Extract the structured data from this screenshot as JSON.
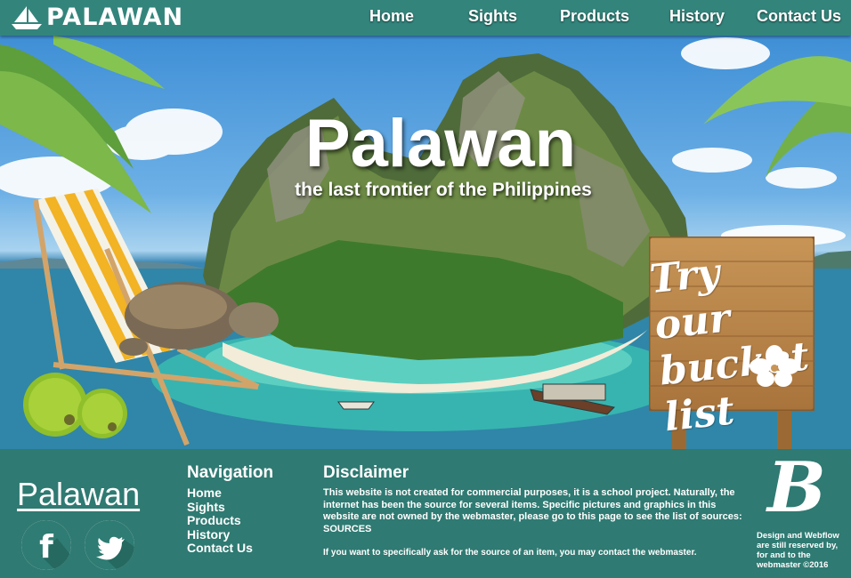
{
  "header": {
    "logo_text": "PALAWAN",
    "nav": [
      {
        "label": "Home"
      },
      {
        "label": "Sights"
      },
      {
        "label": "Products"
      },
      {
        "label": "History"
      },
      {
        "label": "Contact Us"
      }
    ]
  },
  "hero": {
    "title": "Palawan",
    "subtitle": "the last frontier of the Philippines",
    "sign_lines": [
      "Try our",
      "bucket",
      "list"
    ]
  },
  "footer": {
    "brand": "Palawan",
    "social": [
      {
        "icon": "facebook-icon",
        "glyph": "f"
      },
      {
        "icon": "twitter-icon"
      }
    ],
    "navigation_heading": "Navigation",
    "navigation_links": [
      "Home",
      "Sights",
      "Products",
      "History",
      "Contact Us"
    ],
    "disclaimer_heading": "Disclaimer",
    "disclaimer_text": "This website is not created for commercial purposes, it is a school project. Naturally, the internet has been the source for several items. Specific pictures and graphics in this website are not owned by the webmaster, please go to this page to see the list of sources: SOURCES",
    "disclaimer_contact": "If you want to specifically ask for the source of an item, you may contact the webmaster.",
    "badge_letter": "B",
    "credits": "Design and Webflow are still reserved by, for and to the webmaster ©2016"
  },
  "colors": {
    "teal": "#33857c",
    "footer_teal": "#2f7a72",
    "white": "#ffffff"
  }
}
